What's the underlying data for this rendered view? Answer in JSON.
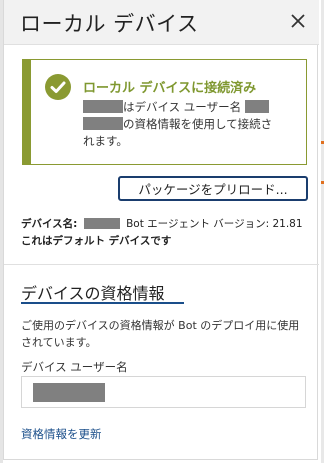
{
  "panel": {
    "title": "ローカル デバイス"
  },
  "status": {
    "title": "ローカル デバイスに接続済み",
    "line1_text": "はデバイス ユーザー名",
    "line2_text": "の資格情報を使用して接続さ",
    "line3_text": "れます。"
  },
  "actions": {
    "preload_label": "パッケージをプリロード..."
  },
  "device_info": {
    "name_label": "デバイス名:",
    "agent_label": "Bot エージェント バージョン: 21.81",
    "default_text": "これはデフォルト デバイスです"
  },
  "credentials": {
    "section_title": "デバイスの資格情報",
    "description": "ご使用のデバイスの資格情報が Bot のデプロイ用に使用されています。",
    "username_label": "デバイス ユーザー名",
    "update_link": "資格情報を更新"
  },
  "colors": {
    "accent_green": "#8a9a32",
    "status_text_green": "#7f9830",
    "link_blue": "#1a4e8a",
    "button_border": "#1a3d6e",
    "redaction": "#808080"
  },
  "icons": {
    "close": "close-icon",
    "check": "check-circle-icon"
  }
}
